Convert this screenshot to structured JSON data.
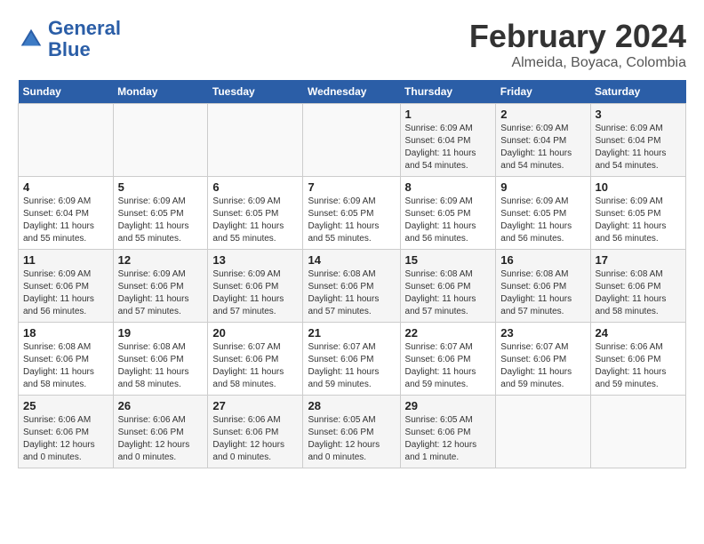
{
  "header": {
    "logo_line1": "General",
    "logo_line2": "Blue",
    "month": "February 2024",
    "location": "Almeida, Boyaca, Colombia"
  },
  "days_of_week": [
    "Sunday",
    "Monday",
    "Tuesday",
    "Wednesday",
    "Thursday",
    "Friday",
    "Saturday"
  ],
  "weeks": [
    [
      {
        "day": "",
        "info": ""
      },
      {
        "day": "",
        "info": ""
      },
      {
        "day": "",
        "info": ""
      },
      {
        "day": "",
        "info": ""
      },
      {
        "day": "1",
        "info": "Sunrise: 6:09 AM\nSunset: 6:04 PM\nDaylight: 11 hours\nand 54 minutes."
      },
      {
        "day": "2",
        "info": "Sunrise: 6:09 AM\nSunset: 6:04 PM\nDaylight: 11 hours\nand 54 minutes."
      },
      {
        "day": "3",
        "info": "Sunrise: 6:09 AM\nSunset: 6:04 PM\nDaylight: 11 hours\nand 54 minutes."
      }
    ],
    [
      {
        "day": "4",
        "info": "Sunrise: 6:09 AM\nSunset: 6:04 PM\nDaylight: 11 hours\nand 55 minutes."
      },
      {
        "day": "5",
        "info": "Sunrise: 6:09 AM\nSunset: 6:05 PM\nDaylight: 11 hours\nand 55 minutes."
      },
      {
        "day": "6",
        "info": "Sunrise: 6:09 AM\nSunset: 6:05 PM\nDaylight: 11 hours\nand 55 minutes."
      },
      {
        "day": "7",
        "info": "Sunrise: 6:09 AM\nSunset: 6:05 PM\nDaylight: 11 hours\nand 55 minutes."
      },
      {
        "day": "8",
        "info": "Sunrise: 6:09 AM\nSunset: 6:05 PM\nDaylight: 11 hours\nand 56 minutes."
      },
      {
        "day": "9",
        "info": "Sunrise: 6:09 AM\nSunset: 6:05 PM\nDaylight: 11 hours\nand 56 minutes."
      },
      {
        "day": "10",
        "info": "Sunrise: 6:09 AM\nSunset: 6:05 PM\nDaylight: 11 hours\nand 56 minutes."
      }
    ],
    [
      {
        "day": "11",
        "info": "Sunrise: 6:09 AM\nSunset: 6:06 PM\nDaylight: 11 hours\nand 56 minutes."
      },
      {
        "day": "12",
        "info": "Sunrise: 6:09 AM\nSunset: 6:06 PM\nDaylight: 11 hours\nand 57 minutes."
      },
      {
        "day": "13",
        "info": "Sunrise: 6:09 AM\nSunset: 6:06 PM\nDaylight: 11 hours\nand 57 minutes."
      },
      {
        "day": "14",
        "info": "Sunrise: 6:08 AM\nSunset: 6:06 PM\nDaylight: 11 hours\nand 57 minutes."
      },
      {
        "day": "15",
        "info": "Sunrise: 6:08 AM\nSunset: 6:06 PM\nDaylight: 11 hours\nand 57 minutes."
      },
      {
        "day": "16",
        "info": "Sunrise: 6:08 AM\nSunset: 6:06 PM\nDaylight: 11 hours\nand 57 minutes."
      },
      {
        "day": "17",
        "info": "Sunrise: 6:08 AM\nSunset: 6:06 PM\nDaylight: 11 hours\nand 58 minutes."
      }
    ],
    [
      {
        "day": "18",
        "info": "Sunrise: 6:08 AM\nSunset: 6:06 PM\nDaylight: 11 hours\nand 58 minutes."
      },
      {
        "day": "19",
        "info": "Sunrise: 6:08 AM\nSunset: 6:06 PM\nDaylight: 11 hours\nand 58 minutes."
      },
      {
        "day": "20",
        "info": "Sunrise: 6:07 AM\nSunset: 6:06 PM\nDaylight: 11 hours\nand 58 minutes."
      },
      {
        "day": "21",
        "info": "Sunrise: 6:07 AM\nSunset: 6:06 PM\nDaylight: 11 hours\nand 59 minutes."
      },
      {
        "day": "22",
        "info": "Sunrise: 6:07 AM\nSunset: 6:06 PM\nDaylight: 11 hours\nand 59 minutes."
      },
      {
        "day": "23",
        "info": "Sunrise: 6:07 AM\nSunset: 6:06 PM\nDaylight: 11 hours\nand 59 minutes."
      },
      {
        "day": "24",
        "info": "Sunrise: 6:06 AM\nSunset: 6:06 PM\nDaylight: 11 hours\nand 59 minutes."
      }
    ],
    [
      {
        "day": "25",
        "info": "Sunrise: 6:06 AM\nSunset: 6:06 PM\nDaylight: 12 hours\nand 0 minutes."
      },
      {
        "day": "26",
        "info": "Sunrise: 6:06 AM\nSunset: 6:06 PM\nDaylight: 12 hours\nand 0 minutes."
      },
      {
        "day": "27",
        "info": "Sunrise: 6:06 AM\nSunset: 6:06 PM\nDaylight: 12 hours\nand 0 minutes."
      },
      {
        "day": "28",
        "info": "Sunrise: 6:05 AM\nSunset: 6:06 PM\nDaylight: 12 hours\nand 0 minutes."
      },
      {
        "day": "29",
        "info": "Sunrise: 6:05 AM\nSunset: 6:06 PM\nDaylight: 12 hours\nand 1 minute."
      },
      {
        "day": "",
        "info": ""
      },
      {
        "day": "",
        "info": ""
      }
    ]
  ]
}
